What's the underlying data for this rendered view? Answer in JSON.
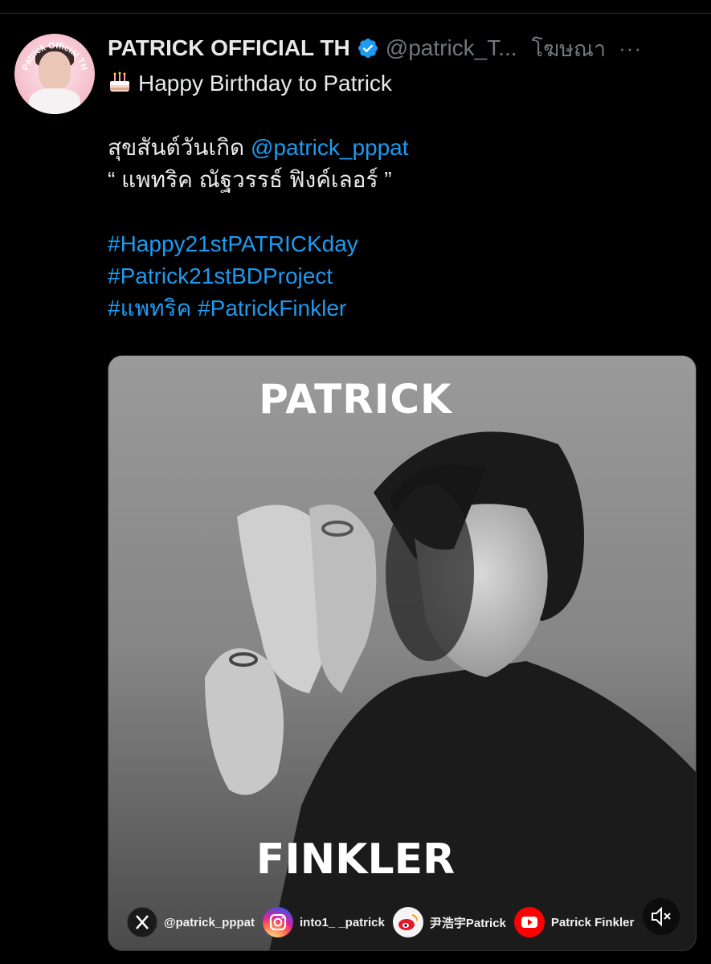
{
  "tweet": {
    "display_name": "PATRICK OFFICIAL TH",
    "handle": "@patrick_T...",
    "promoted_label": "โฆษณา",
    "more_label": "···",
    "avatar_text": "Patrick Official TH",
    "lines": {
      "greeting": "Happy Birthday to Patrick",
      "thai_prefix": "สุขสันต์วันเกิด ",
      "mention": "@patrick_pppat",
      "thai_name": "“ แพทริค ณัฐวรรธ์ ฟิงค์เลอร์ ”",
      "hashtag1": "#Happy21stPATRICKday",
      "hashtag2": "#Patrick21stBDProject",
      "hashtag3": "#แพทริค #PatrickFinkler"
    }
  },
  "media": {
    "title_top": "PATRICK",
    "title_bottom": "FINKLER",
    "socials": [
      {
        "icon": "x-icon",
        "label": "@patrick_pppat"
      },
      {
        "icon": "instagram-icon",
        "label": "into1_ _patrick"
      },
      {
        "icon": "weibo-icon",
        "label": "尹浩宇Patrick"
      },
      {
        "icon": "youtube-icon",
        "label": "Patrick Finkler"
      }
    ],
    "mute_icon": "mute-icon"
  },
  "colors": {
    "background": "#000000",
    "text": "#e7e9ea",
    "muted": "#71767b",
    "link": "#1d9bf0",
    "verified": "#1d9bf0"
  }
}
